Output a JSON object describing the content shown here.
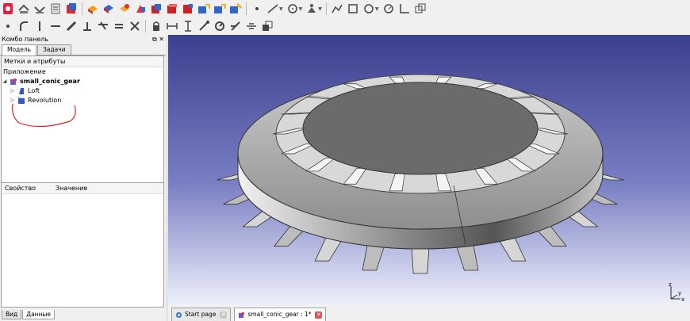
{
  "toolbar_icons": {
    "row1": [
      "new-file-icon",
      "open-icon",
      "save-icon",
      "saveas-icon",
      "cube-view-icon",
      "box-icon",
      "cylinder-icon",
      "sphere-icon",
      "shape-builder-icon",
      "primitive-icon",
      "extrude-icon",
      "revolve-icon",
      "mirror-icon",
      "fillet-icon",
      "chamfer-icon",
      "point-icon",
      "line-icon",
      "circle-icon",
      "sketch-icon",
      "polyline-icon",
      "rectangle-icon",
      "arc-icon",
      "clock-icon",
      "trim-icon",
      "copy-icon"
    ],
    "row2": [
      "point-icon",
      "arc-icon",
      "line-vertical-icon",
      "line-diagonal-icon",
      "perpendicular-icon",
      "tangent-icon",
      "equal-icon",
      "lock-icon",
      "horizontal-distance-icon",
      "vertical-distance-icon",
      "radius-icon",
      "angle-icon",
      "snap-icon",
      "copy-icon"
    ]
  },
  "combo": {
    "title": "Комбо панель",
    "buttons": "⧉ ✕",
    "tabs": [
      "Модель",
      "Задачи"
    ],
    "tree_header": "Метки и атрибуты",
    "section": "Приложение",
    "root": {
      "label": "small_conic_gear",
      "icon": "document-icon"
    },
    "children": [
      {
        "label": "Loft",
        "icon": "loft-icon"
      },
      {
        "label": "Revolution",
        "icon": "revolution-icon"
      }
    ],
    "props_cols": [
      "Свойство",
      "Значение"
    ],
    "bottom_tabs": [
      "Вид",
      "Данные"
    ]
  },
  "document_tabs": [
    {
      "label": "Start page",
      "icon": "start-page-icon"
    },
    {
      "label": "small_conic_gear : 1*",
      "icon": "freecad-doc-icon"
    }
  ],
  "view3d": {
    "axis_labels": [
      "z",
      "y",
      "x"
    ],
    "colors": {
      "top": "#3b3f8f",
      "bottom": "#eef0fb",
      "annotation": "#e02020"
    }
  }
}
